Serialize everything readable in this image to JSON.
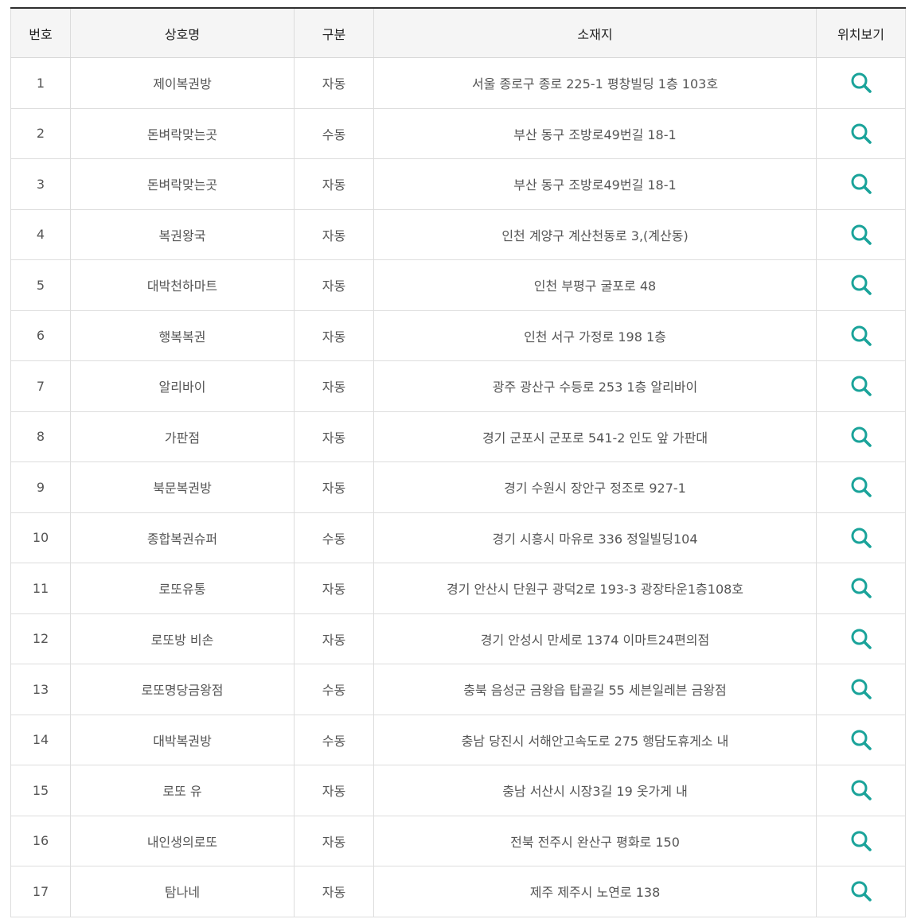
{
  "table": {
    "headers": [
      "번호",
      "상호명",
      "구분",
      "소재지",
      "위치보기"
    ],
    "rows": [
      {
        "no": "1",
        "name": "제이복권방",
        "type": "자동",
        "address": "서울 종로구 종로 225-1 평창빌딩 1층 103호"
      },
      {
        "no": "2",
        "name": "돈벼락맞는곳",
        "type": "수동",
        "address": "부산 동구 조방로49번길 18-1"
      },
      {
        "no": "3",
        "name": "돈벼락맞는곳",
        "type": "자동",
        "address": "부산 동구 조방로49번길 18-1"
      },
      {
        "no": "4",
        "name": "복권왕국",
        "type": "자동",
        "address": "인천 계양구 계산천동로 3,(계산동)"
      },
      {
        "no": "5",
        "name": "대박천하마트",
        "type": "자동",
        "address": "인천 부평구 굴포로 48"
      },
      {
        "no": "6",
        "name": "행복복권",
        "type": "자동",
        "address": "인천 서구 가정로 198 1층"
      },
      {
        "no": "7",
        "name": "알리바이",
        "type": "자동",
        "address": "광주 광산구 수등로 253 1층 알리바이"
      },
      {
        "no": "8",
        "name": "가판점",
        "type": "자동",
        "address": "경기 군포시 군포로 541-2 인도 앞 가판대"
      },
      {
        "no": "9",
        "name": "북문복권방",
        "type": "자동",
        "address": "경기 수원시 장안구 정조로 927-1"
      },
      {
        "no": "10",
        "name": "종합복권슈퍼",
        "type": "수동",
        "address": "경기 시흥시 마유로 336 정일빌딩104"
      },
      {
        "no": "11",
        "name": "로또유통",
        "type": "자동",
        "address": "경기 안산시 단원구 광덕2로 193-3 광장타운1층108호"
      },
      {
        "no": "12",
        "name": "로또방 비손",
        "type": "자동",
        "address": "경기 안성시 만세로 1374 이마트24편의점"
      },
      {
        "no": "13",
        "name": "로또명당금왕점",
        "type": "수동",
        "address": "충북 음성군 금왕읍 탑골길 55 세븐일레븐 금왕점"
      },
      {
        "no": "14",
        "name": "대박복권방",
        "type": "수동",
        "address": "충남 당진시 서해안고속도로 275 행담도휴게소 내"
      },
      {
        "no": "15",
        "name": "로또 유",
        "type": "자동",
        "address": "충남 서산시 시장3길 19 옷가게 내"
      },
      {
        "no": "16",
        "name": "내인생의로또",
        "type": "자동",
        "address": "전북 전주시 완산구 평화로 150"
      },
      {
        "no": "17",
        "name": "탐나네",
        "type": "자동",
        "address": "제주 제주시 노연로 138"
      }
    ]
  },
  "icons": {
    "location": "search-icon"
  },
  "colors": {
    "accent": "#1aa39a",
    "header_bg": "#f5f5f5",
    "text": "#555555"
  }
}
